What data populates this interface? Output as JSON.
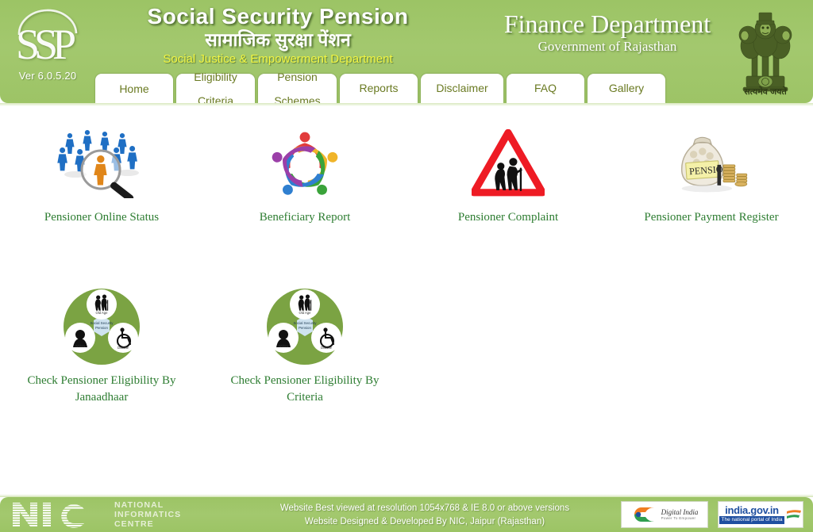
{
  "header": {
    "logo_alt": "SSP",
    "version": "Ver 6.0.5.20",
    "title_main": "Social Security Pension",
    "title_hindi": "सामाजिक सुरक्षा पेंशन",
    "title_sub": "Social Justice & Empowerment Department",
    "dept_title": "Finance Department",
    "dept_sub": "Government of Rajasthan",
    "emblem_caption": "सत्यमेव जयते",
    "bg_color": "#9cc465",
    "sub_color": "#f2f542"
  },
  "nav": {
    "tabs": [
      {
        "label": "Home",
        "lines": [
          "Home"
        ],
        "width": 98,
        "active": true
      },
      {
        "label": "Eligibility Criteria",
        "lines": [
          "Eligibility",
          "Criteria"
        ],
        "width": 99,
        "active": false
      },
      {
        "label": "Pension Schemes",
        "lines": [
          "Pension",
          "Schemes"
        ],
        "width": 99,
        "active": false
      },
      {
        "label": "Reports",
        "lines": [
          "Reports"
        ],
        "width": 98,
        "active": false
      },
      {
        "label": "Disclaimer",
        "lines": [
          "Disclaimer"
        ],
        "width": 104,
        "active": false
      },
      {
        "label": "FAQ",
        "lines": [
          "FAQ"
        ],
        "width": 98,
        "active": false
      },
      {
        "label": "Gallery",
        "lines": [
          "Gallery"
        ],
        "width": 98,
        "active": false
      }
    ],
    "text_color": "#6a7a22"
  },
  "main": {
    "link_color": "#2e7d32",
    "tiles_row1": [
      {
        "label": "Pensioner Online Status",
        "icon": "people-search-icon"
      },
      {
        "label": "Beneficiary Report",
        "icon": "people-star-icon"
      },
      {
        "label": "Pensioner Complaint",
        "icon": "elderly-warning-sign-icon"
      },
      {
        "label": "Pensioner Payment Register",
        "icon": "pension-money-bag-icon"
      }
    ],
    "tiles_row2": [
      {
        "label": "Check Pensioner Eligibility By Janaadhaar",
        "icon": "eligibility-circle-icon"
      },
      {
        "label": "Check Pensioner Eligibility By Criteria",
        "icon": "eligibility-circle-icon"
      }
    ],
    "eligibility_icon_labels": {
      "top": "Old Age",
      "left": "Widow",
      "right": "Disable",
      "center": "Social Security Pension"
    },
    "money_bag_label": "PENSION"
  },
  "footer": {
    "nic_abbr": "NIC",
    "nic_line1": "NATIONAL",
    "nic_line2": "INFORMATICS",
    "nic_line3": "CENTRE",
    "note_line1": "Website Best viewed at resolution 1054x768 & IE 8.0 or above versions",
    "note_line2": "Website Designed & Developed By NIC, Jaipur (Rajasthan)",
    "digital_india_label": "Digital India",
    "digital_india_sub": "Power To Empower",
    "india_gov_label": "india.gov.in",
    "india_gov_sub": "The national portal of India"
  }
}
